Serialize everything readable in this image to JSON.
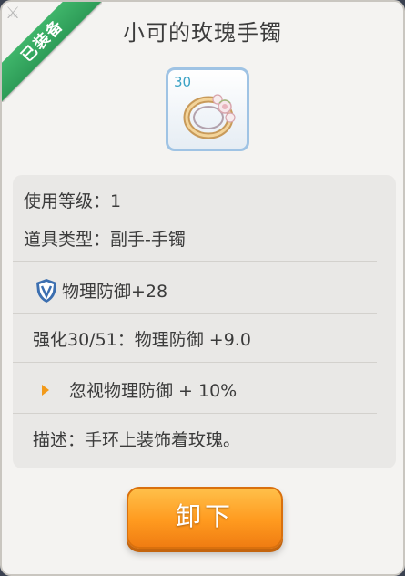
{
  "header": {
    "title": "小可的玫瑰手镯",
    "equipped_badge": "已装备",
    "corner_glyph": "⚔"
  },
  "item": {
    "level": "30",
    "icon": "rose-bracelet-icon"
  },
  "info": {
    "use_level": "使用等级：1",
    "item_type": "道具类型：副手-手镯",
    "base_stat": "物理防御+28",
    "enhance": "强化30/51：物理防御 +9.0",
    "special": "忽视物理防御 + 10%",
    "description": "描述：手环上装饰着玫瑰。"
  },
  "actions": {
    "unequip_label": "卸下"
  },
  "colors": {
    "ribbon": "#34a860",
    "button": "#ff9a1f",
    "item_border": "#9fc3e4",
    "arrow": "#f29a1a"
  }
}
